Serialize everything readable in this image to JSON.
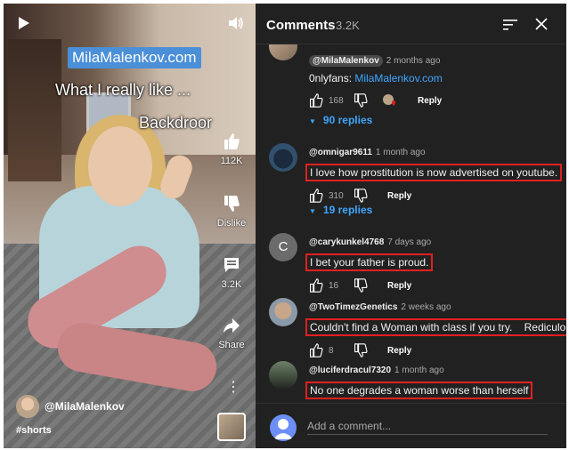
{
  "video": {
    "banner": "MilaMalenkov.com",
    "caption_1": "What I really like ...",
    "caption_2": "Backdroor",
    "like_count": "112K",
    "dislike_label": "Dislike",
    "comment_count": "3.2K",
    "share_label": "Share",
    "more_glyph": "⋮",
    "channel_name": "@MilaMalenkov",
    "hashtag": "#shorts"
  },
  "comments_panel": {
    "title": "Comments",
    "count": "3.2K",
    "add_placeholder": "Add a comment..."
  },
  "comments": [
    {
      "author": "@MilaMalenkov",
      "time": "2 months ago",
      "text_prefix": "0nlyfans: ",
      "text_link": "MilaMalenkov.com",
      "likes": "168",
      "reply": "Reply",
      "replies": "90 replies"
    },
    {
      "author": "@omnigar9611",
      "time": "1 month ago",
      "text": "I love how prostitution is now advertised on youtube.",
      "likes": "310",
      "reply": "Reply",
      "replies": "19 replies"
    },
    {
      "author": "@carykunkel4768",
      "time": "7 days ago",
      "avatar_letter": "C",
      "text": "I bet your father is proud.",
      "likes": "16",
      "reply": "Reply"
    },
    {
      "author": "@TwoTimezGenetics",
      "time": "2 weeks ago",
      "text": "Couldn't find a Woman with class if you try.    Rediculous",
      "likes": "8",
      "reply": "Reply"
    },
    {
      "author": "@luciferdracul7320",
      "time": "1 month ago",
      "text": "No one degrades a woman worse than herself"
    }
  ],
  "colors": {
    "accent_link": "#3ea6ff",
    "highlight_box": "#e02020",
    "panel_bg": "#212121"
  }
}
